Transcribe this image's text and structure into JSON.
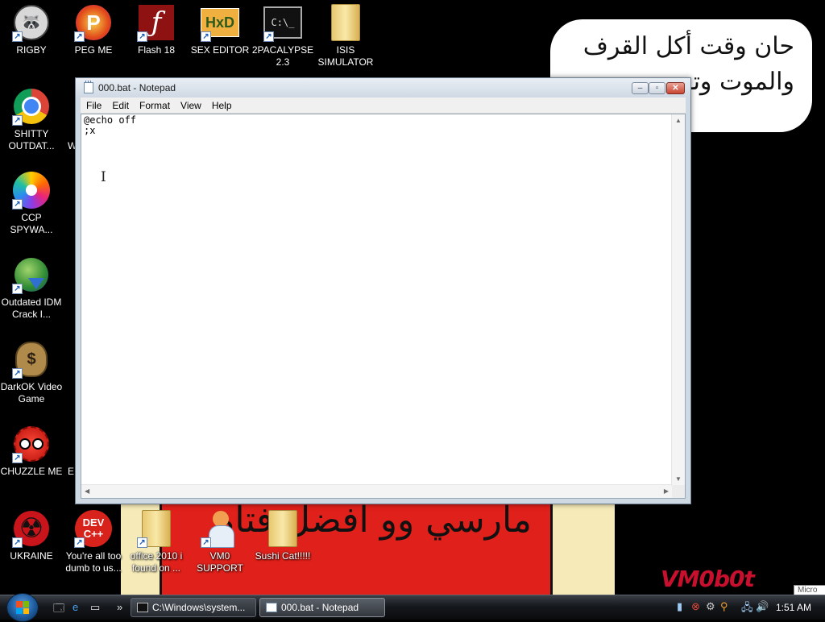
{
  "desktop": {
    "icons": [
      {
        "label": "RIGBY",
        "glyph": "🦝"
      },
      {
        "label": "PEG ME",
        "glyph": "P"
      },
      {
        "label": "Flash 18",
        "glyph": "ƒ"
      },
      {
        "label": "SEX EDITOR",
        "glyph": "HxD"
      },
      {
        "label": "2PACALYPSE 2.3",
        "glyph": "C:\\_"
      },
      {
        "label": "ISIS SIMULATOR",
        "glyph": "📁"
      },
      {
        "label": "SHITTY OUTDAT...",
        "glyph": "chrome"
      },
      {
        "label": "CCP SPYWA...",
        "glyph": "pinwheel"
      },
      {
        "label": "Outdated IDM Crack I...",
        "glyph": "🌐"
      },
      {
        "label": "DarkOK Video Game",
        "glyph": "💰"
      },
      {
        "label": "CHUZZLE ME",
        "glyph": "●"
      },
      {
        "label": "UKRAINE",
        "glyph": "☢"
      },
      {
        "label": "You're all too dumb to us...",
        "glyph": "DEV C++"
      },
      {
        "label": "office 2010 i found on ...",
        "glyph": "📁"
      },
      {
        "label": "VM0 SUPPORT",
        "glyph": "👤"
      },
      {
        "label": "Sushi Cat!!!!!",
        "glyph": "📁"
      }
    ],
    "partial_labels": {
      "w": "W",
      "e": "E"
    }
  },
  "wallpaper": {
    "speech_bubble": "حان وقت أكل القرف\nوالموت وتـ...",
    "banner": "مارسي وو افضل فتاة",
    "signature": "VM0b0t",
    "tooltip_fragment": "Micro"
  },
  "notepad": {
    "title": "000.bat - Notepad",
    "menu": [
      "File",
      "Edit",
      "Format",
      "View",
      "Help"
    ],
    "content": "@echo off\n;x",
    "caption_buttons": {
      "minimize": "–",
      "maximize": "▫",
      "close": "✕"
    }
  },
  "taskbar": {
    "tasks": [
      {
        "label": "C:\\Windows\\system..."
      },
      {
        "label": "000.bat - Notepad"
      }
    ],
    "clock": "1:51 AM",
    "quick_launch_more": "»"
  },
  "colors": {
    "accent_close": "#c94533",
    "wallpaper_red": "#e0201a",
    "signature_red": "#c8102e"
  }
}
